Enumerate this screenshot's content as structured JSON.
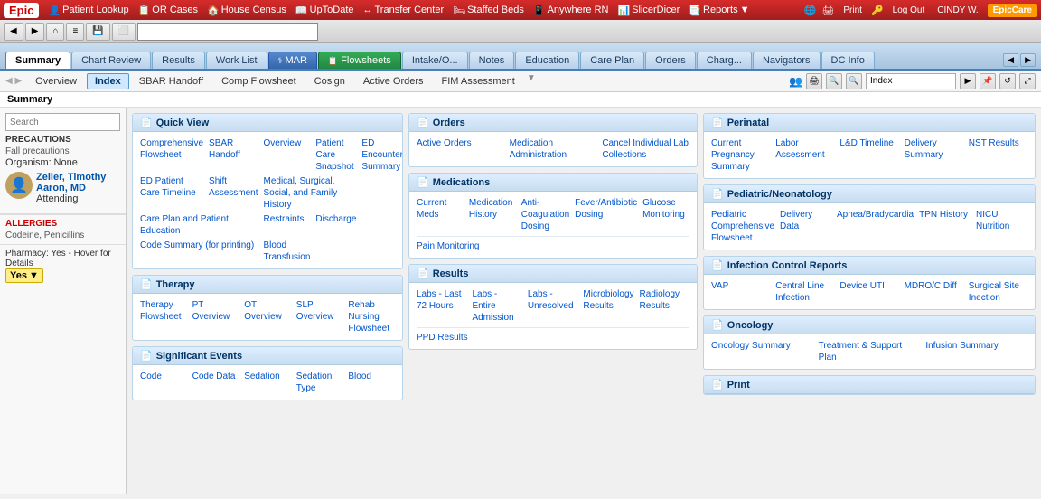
{
  "topNav": {
    "logo": "Epic",
    "items": [
      {
        "label": "Patient Lookup",
        "icon": "👤"
      },
      {
        "label": "OR Cases",
        "icon": "📋"
      },
      {
        "label": "House Census",
        "icon": "🏠"
      },
      {
        "label": "UpToDate",
        "icon": "📖"
      },
      {
        "label": "Transfer Center",
        "icon": "↔"
      },
      {
        "label": "Staffed Beds",
        "icon": "🛏"
      },
      {
        "label": "Anywhere RN",
        "icon": "📱"
      },
      {
        "label": "SlicerDicer",
        "icon": "📊"
      },
      {
        "label": "Reports",
        "icon": "📑"
      }
    ],
    "right": {
      "globe": "🌐",
      "print": "Print",
      "logout": "Log Out",
      "user": "CINDY W.",
      "epiccare": "EpicCare"
    }
  },
  "toolbar": {
    "buttons": [
      "◀",
      "▶",
      "⌂",
      "≡",
      "🖫",
      "⬜"
    ],
    "search_placeholder": ""
  },
  "tabs": {
    "items": [
      {
        "label": "Summary",
        "active": true
      },
      {
        "label": "Chart Review"
      },
      {
        "label": "Results"
      },
      {
        "label": "Work List"
      },
      {
        "label": "MAR",
        "special": "mar"
      },
      {
        "label": "Flowsheets",
        "special": "flowsheets"
      },
      {
        "label": "Intake/O..."
      },
      {
        "label": "Notes"
      },
      {
        "label": "Education"
      },
      {
        "label": "Care Plan"
      },
      {
        "label": "Orders"
      },
      {
        "label": "Charg..."
      },
      {
        "label": "Navigators"
      },
      {
        "label": "DC Info"
      }
    ]
  },
  "subTabs": {
    "items": [
      {
        "label": "Overview"
      },
      {
        "label": "Index",
        "active": true
      },
      {
        "label": "SBAR Handoff"
      },
      {
        "label": "Comp Flowsheet"
      },
      {
        "label": "Cosign"
      },
      {
        "label": "Active Orders"
      },
      {
        "label": "FIM Assessment"
      }
    ],
    "search_value": "Index",
    "search_placeholder": "Index"
  },
  "pageTitle": "Summary",
  "sidebar": {
    "search_placeholder": "Search",
    "precautions_header": "PRECAUTIONS",
    "precautions_item": "Fall precautions",
    "organism_label": "Organism:",
    "organism_value": "None",
    "doctor": {
      "name": "Zeller, Timothy Aaron, MD",
      "role": "Attending"
    },
    "allergies_header": "ALLERGIES",
    "allergies": "Codeine, Penicillins",
    "pharmacy_label": "Pharmacy: Yes - Hover for Details",
    "pharmacy_badge": "Yes",
    "pharmacy_badge_arrow": "▼"
  },
  "quickView": {
    "title": "Quick View",
    "links": [
      "Comprehensive Flowsheet",
      "SBAR Handoff",
      "Overview",
      "Patient Care Snapshot",
      "ED Encounter Summary",
      "ED Patient Care Timeline",
      "Shift Assessment",
      "Medical, Surgical, Social, and Family History",
      "Care Plan and Patient Education",
      "Restraints",
      "Discharge",
      "Code Summary (for printing)",
      "Blood Transfusion"
    ]
  },
  "therapy": {
    "title": "Therapy",
    "links": [
      "Therapy Flowsheet",
      "PT Overview",
      "OT Overview",
      "SLP Overview",
      "Rehab Nursing Flowsheet"
    ]
  },
  "significantEvents": {
    "title": "Significant Events",
    "links": [
      "Code",
      "Code Data",
      "Sedation",
      "Sedation Type",
      "Blood"
    ]
  },
  "orders": {
    "title": "Orders",
    "links": [
      "Active Orders",
      "Medication Administration",
      "Cancel Individual Lab Collections"
    ]
  },
  "medications": {
    "title": "Medications",
    "links": [
      "Current Meds",
      "Medication History",
      "Anti-Coagulation Dosing",
      "Fever/Antibiotic Dosing",
      "Glucose Monitoring",
      "Pain Monitoring"
    ]
  },
  "results": {
    "title": "Results",
    "links": [
      "Labs - Last 72 Hours",
      "Labs - Entire Admission",
      "Labs - Unresolved",
      "Microbiology Results",
      "Radiology Results",
      "PPD Results"
    ]
  },
  "perinatal": {
    "title": "Perinatal",
    "links": [
      "Current Pregnancy Summary",
      "Labor Assessment",
      "L&D Timeline",
      "Delivery Summary",
      "NST Results"
    ]
  },
  "pediatricNeonatology": {
    "title": "Pediatric/Neonatology",
    "links": [
      "Pediatric Comprehensive Flowsheet",
      "Delivery Data",
      "Apnea/Bradycardia",
      "TPN History",
      "NICU Nutrition"
    ]
  },
  "infectionControl": {
    "title": "Infection Control Reports",
    "links": [
      "VAP",
      "Central Line Infection",
      "Device UTI",
      "MDRO/C Diff",
      "Surgical Site Inection"
    ]
  },
  "oncology": {
    "title": "Oncology",
    "links": [
      "Oncology Summary",
      "Treatment & Support Plan",
      "Infusion Summary"
    ]
  },
  "print": {
    "title": "Print"
  }
}
